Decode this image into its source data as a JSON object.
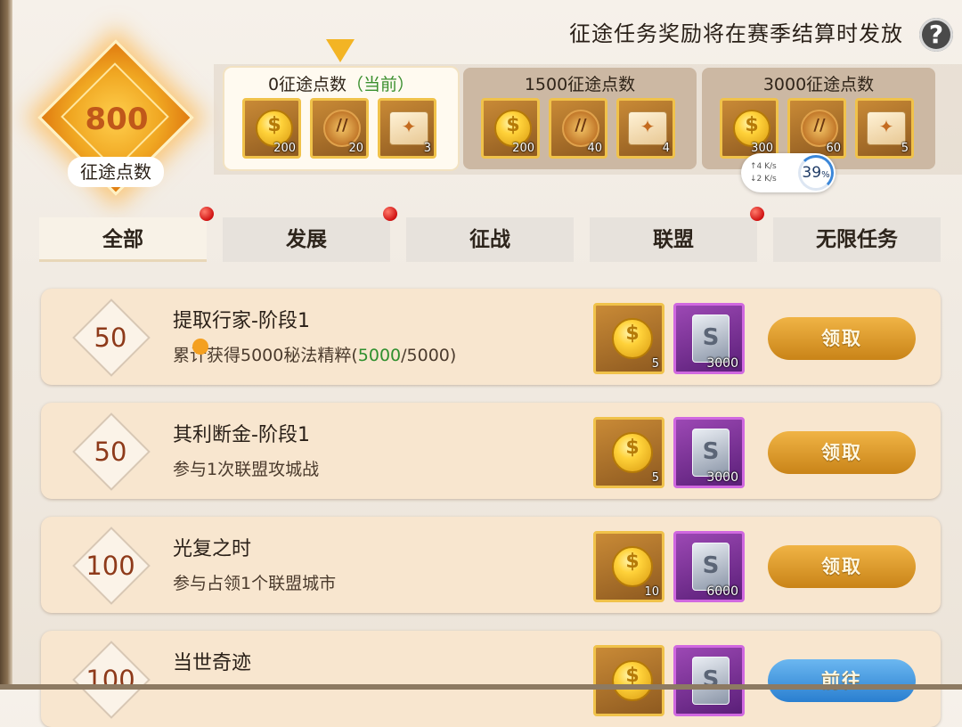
{
  "header": {
    "note": "征途任务奖励将在赛季结算时发放",
    "help_label": "?"
  },
  "points": {
    "value": "800",
    "label": "征途点数"
  },
  "tiers": [
    {
      "label": "0征途点数",
      "current_tag": "（当前）",
      "items": [
        {
          "icon": "gold-coin-icon",
          "qty": "200"
        },
        {
          "icon": "bronze-medal-icon",
          "qty": "20"
        },
        {
          "icon": "scroll-card-icon",
          "qty": "3"
        }
      ]
    },
    {
      "label": "1500征途点数",
      "current_tag": "",
      "items": [
        {
          "icon": "gold-coin-icon",
          "qty": "200"
        },
        {
          "icon": "bronze-medal-icon",
          "qty": "40"
        },
        {
          "icon": "scroll-card-icon",
          "qty": "4"
        }
      ]
    },
    {
      "label": "3000征途点数",
      "current_tag": "",
      "items": [
        {
          "icon": "gold-coin-icon",
          "qty": "300"
        },
        {
          "icon": "bronze-medal-icon",
          "qty": "60"
        },
        {
          "icon": "scroll-card-icon",
          "qty": "5"
        }
      ]
    }
  ],
  "network": {
    "up": "↑4  K/s",
    "down": "↓2  K/s",
    "percent": "39",
    "percent_unit": "%"
  },
  "tabs": [
    {
      "label": "全部",
      "active": true,
      "dot": true
    },
    {
      "label": "发展",
      "active": false,
      "dot": true
    },
    {
      "label": "征战",
      "active": false,
      "dot": false
    },
    {
      "label": "联盟",
      "active": false,
      "dot": true
    },
    {
      "label": "无限任务",
      "active": false,
      "dot": false
    }
  ],
  "tasks": [
    {
      "points": "50",
      "title": "提取行家-阶段1",
      "desc_prefix": "累计获得5000秘法精粹(",
      "desc_progress": "5000",
      "desc_suffix": "/5000)",
      "rewards": [
        {
          "icon": "gold-coin-icon",
          "qty": "5"
        },
        {
          "icon": "silver-card-icon",
          "qty": "3000"
        }
      ],
      "button": "领取"
    },
    {
      "points": "50",
      "title": "其利断金-阶段1",
      "desc_prefix": "参与1次联盟攻城战",
      "desc_progress": "",
      "desc_suffix": "",
      "rewards": [
        {
          "icon": "gold-coin-icon",
          "qty": "5"
        },
        {
          "icon": "silver-card-icon",
          "qty": "3000"
        }
      ],
      "button": "领取"
    },
    {
      "points": "100",
      "title": "光复之时",
      "desc_prefix": "参与占领1个联盟城市",
      "desc_progress": "",
      "desc_suffix": "",
      "rewards": [
        {
          "icon": "gold-coin-icon",
          "qty": "10"
        },
        {
          "icon": "silver-card-icon",
          "qty": "6000"
        }
      ],
      "button": "领取"
    },
    {
      "points": "100",
      "title": "当世奇迹",
      "desc_prefix": "",
      "desc_progress": "",
      "desc_suffix": "",
      "rewards": [
        {
          "icon": "gold-coin-icon",
          "qty": ""
        },
        {
          "icon": "silver-card-icon",
          "qty": ""
        }
      ],
      "button": "前往"
    }
  ]
}
